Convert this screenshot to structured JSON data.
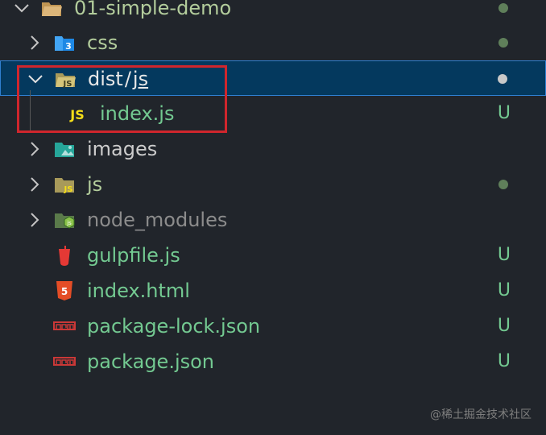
{
  "explorer": {
    "root": {
      "label": "01-simple-demo",
      "icon": "folder-open-icon"
    },
    "rows": [
      {
        "label": "css",
        "icon": "css-folder-icon",
        "status": "modified-dot"
      },
      {
        "label_parts": [
          "dist",
          "/",
          "js"
        ],
        "icon": "js-folder-open-icon",
        "status": "modified-dot",
        "selected": true
      },
      {
        "label": "index.js",
        "icon": "js-file-icon",
        "status_text": "U"
      },
      {
        "label": "images",
        "icon": "images-folder-icon"
      },
      {
        "label": "js",
        "icon": "js-folder-icon",
        "status": "modified-dot"
      },
      {
        "label": "node_modules",
        "icon": "node-folder-icon"
      },
      {
        "label": "gulpfile.js",
        "icon": "gulp-icon",
        "status_text": "U"
      },
      {
        "label": "index.html",
        "icon": "html5-icon",
        "status_text": "U"
      },
      {
        "label": "package-lock.json",
        "icon": "npm-icon",
        "status_text": "U"
      },
      {
        "label": "package.json",
        "icon": "npm-icon",
        "status_text": "U"
      }
    ]
  },
  "watermark": "@稀土掘金技术社区",
  "colors": {
    "background": "#21252b",
    "selection": "#04395e",
    "selection_border": "#2f7fd0",
    "untracked": "#73c991",
    "modified": "#b3cd9c",
    "ignored": "#8c8c8c",
    "annotation_box": "#d0262d"
  }
}
